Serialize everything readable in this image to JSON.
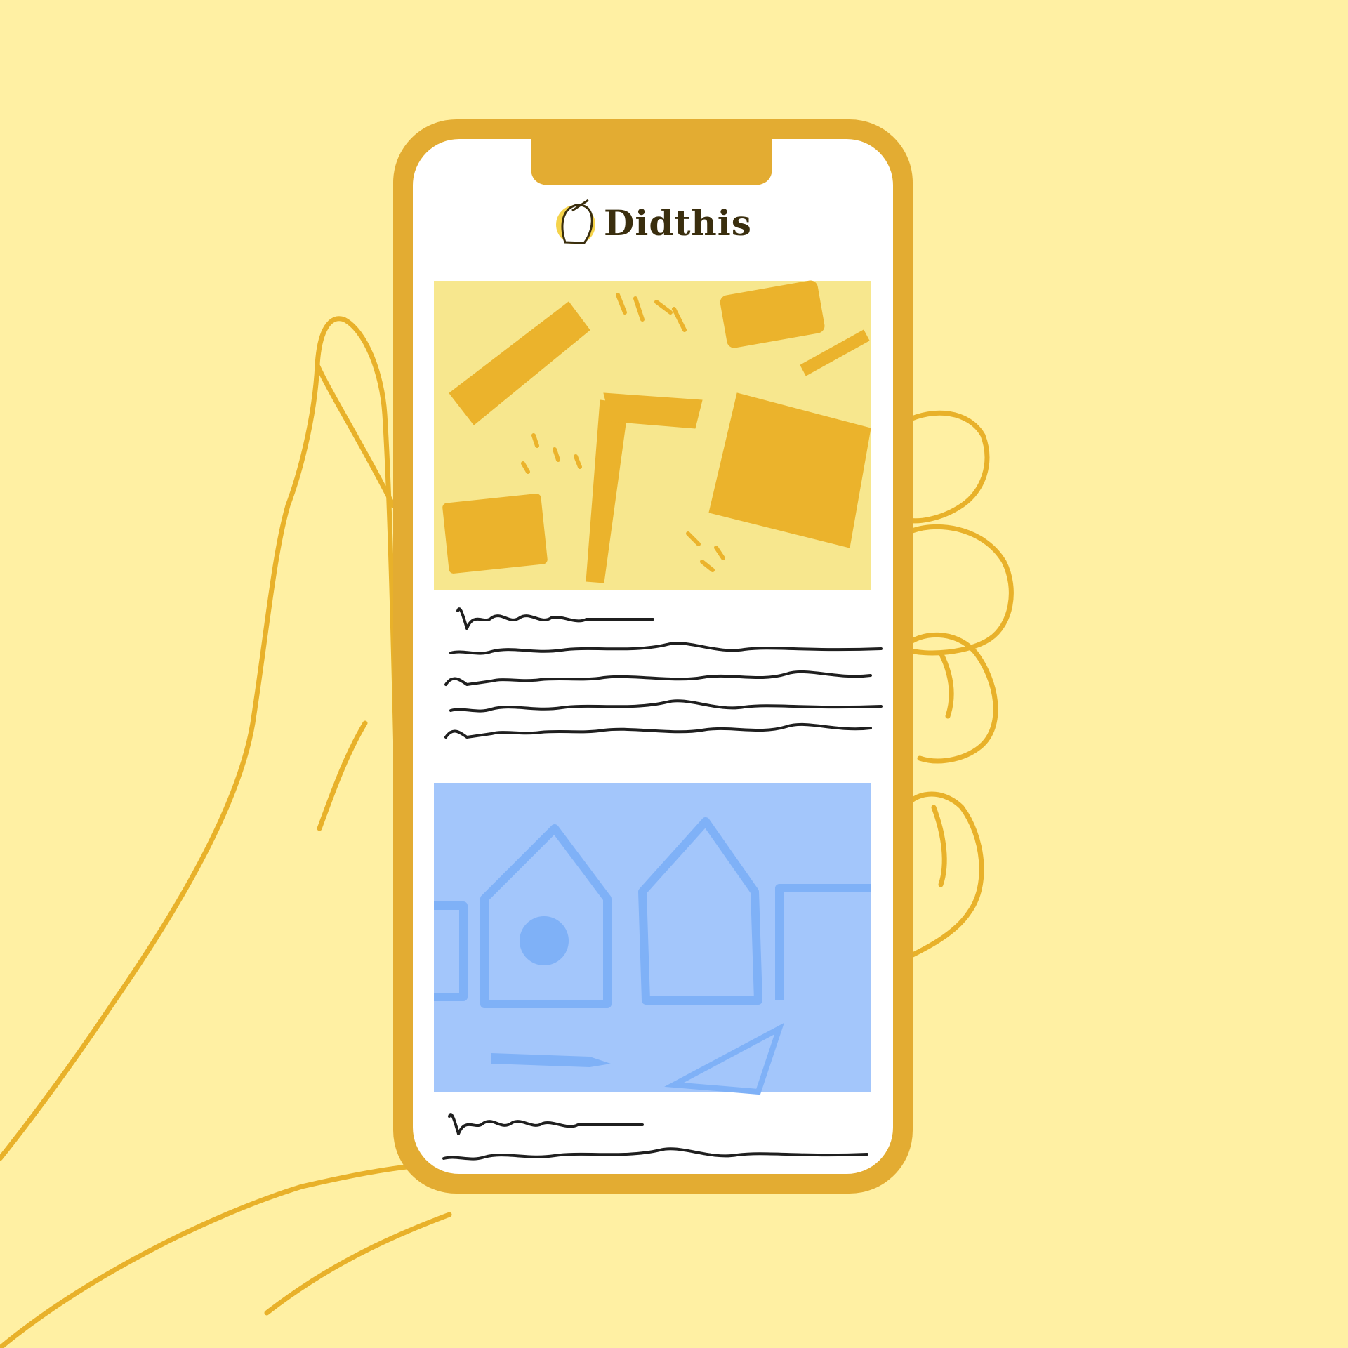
{
  "colors": {
    "background": "#fff0a3",
    "accent": "#e8b12a",
    "phone_frame": "#e3ac32",
    "screen": "#ffffff",
    "card_yellow": "#f7e78e",
    "card_blue": "#a3c6fb",
    "card_blue_drawing": "#7fb1f7",
    "text_dark": "#3a2e0e"
  },
  "app": {
    "title": "Didthis",
    "logo_icon": "hand-pencil-logo-icon"
  },
  "feed": {
    "cards": [
      {
        "image_icon": "crafting-tools-illustration",
        "image_color": "#f7e78e"
      },
      {
        "image_icon": "houses-illustration",
        "image_color": "#a3c6fb"
      }
    ]
  }
}
